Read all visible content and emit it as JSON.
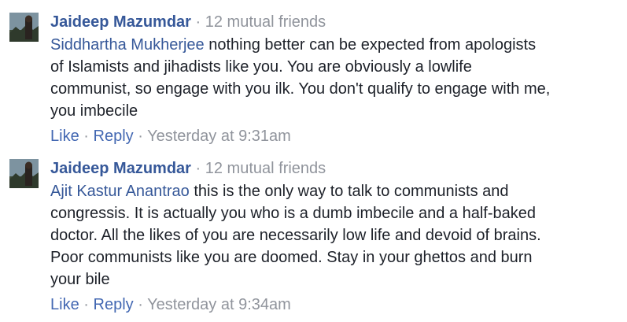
{
  "comments": [
    {
      "author": "Jaideep Mazumdar",
      "separator": "·",
      "mutual": "12 mutual friends",
      "mention": "Siddhartha Mukherjee",
      "text_lines": [
        " nothing better can be expected from apologists",
        "of Islamists and jihadists like you. You are obviously a lowlife",
        "communist, so engage with you ilk. You don't qualify to engage with me,",
        "you imbecile"
      ],
      "like": "Like",
      "reply": "Reply",
      "timestamp": "Yesterday at 9:31am",
      "action_sep": "·"
    },
    {
      "author": "Jaideep Mazumdar",
      "separator": "·",
      "mutual": "12 mutual friends",
      "mention": "Ajit Kastur Anantrao",
      "text_lines": [
        " this is the only way to talk to communists and",
        "congressis. It is actually you who is a dumb imbecile and a half-baked",
        "doctor. All the likes of you are necessarily low life and devoid of brains.",
        "Poor communists like you are doomed. Stay in your ghettos and burn",
        "your bile"
      ],
      "like": "Like",
      "reply": "Reply",
      "timestamp": "Yesterday at 9:34am",
      "action_sep": "·"
    }
  ],
  "colors": {
    "link": "#365899",
    "action": "#4267b2",
    "meta": "#90949c",
    "text": "#1d2129"
  }
}
